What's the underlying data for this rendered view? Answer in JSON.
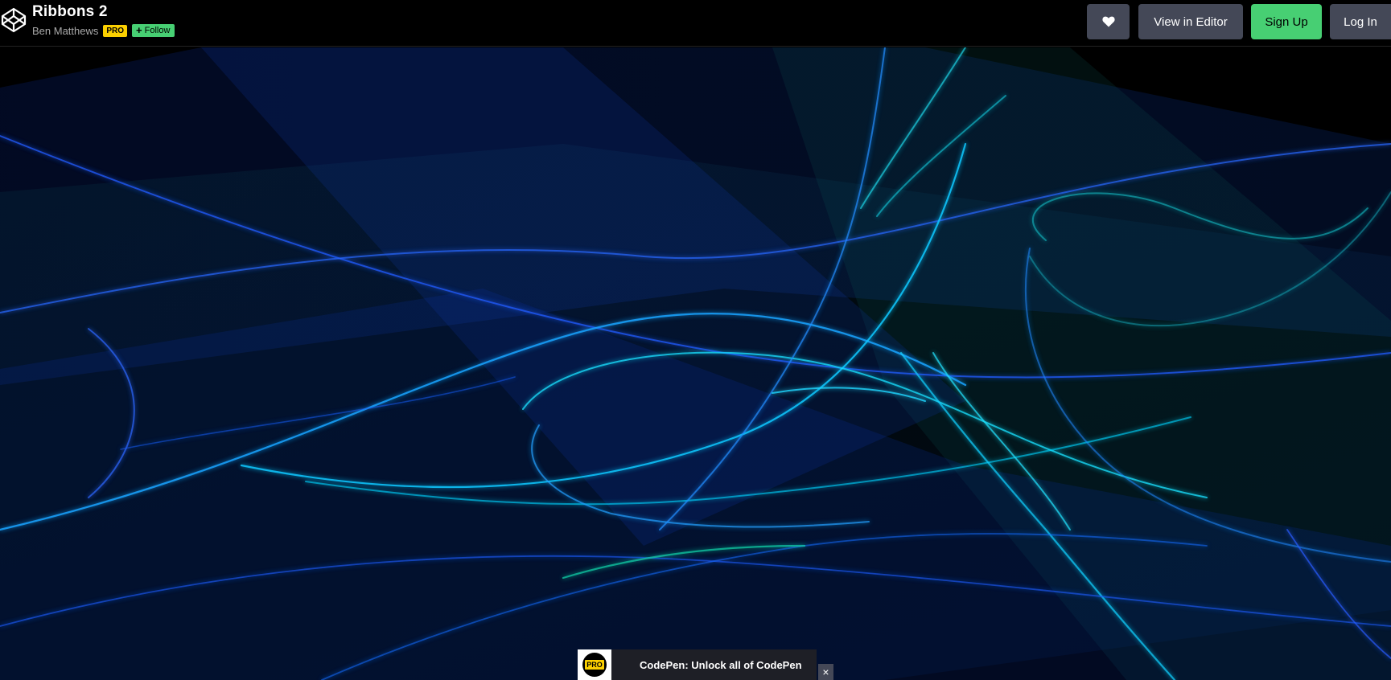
{
  "header": {
    "title": "Ribbons 2",
    "author": "Ben Matthews",
    "pro_badge": "PRO",
    "follow_label": "Follow",
    "logo_icon": "codepen-logo-icon"
  },
  "actions": {
    "heart_icon": "heart-icon",
    "view_in_editor": "View in Editor",
    "sign_up": "Sign Up",
    "log_in": "Log In"
  },
  "promo": {
    "badge": "PRO",
    "text": "CodePen: Unlock all of CodePen",
    "close": "×"
  },
  "colors": {
    "green": "#47cf73",
    "button_gray": "#444857",
    "pro_yellow": "#fcd000",
    "ribbon_blue": "#1f5cff",
    "ribbon_cyan": "#18e0ff",
    "ribbon_teal": "#1aa890"
  }
}
